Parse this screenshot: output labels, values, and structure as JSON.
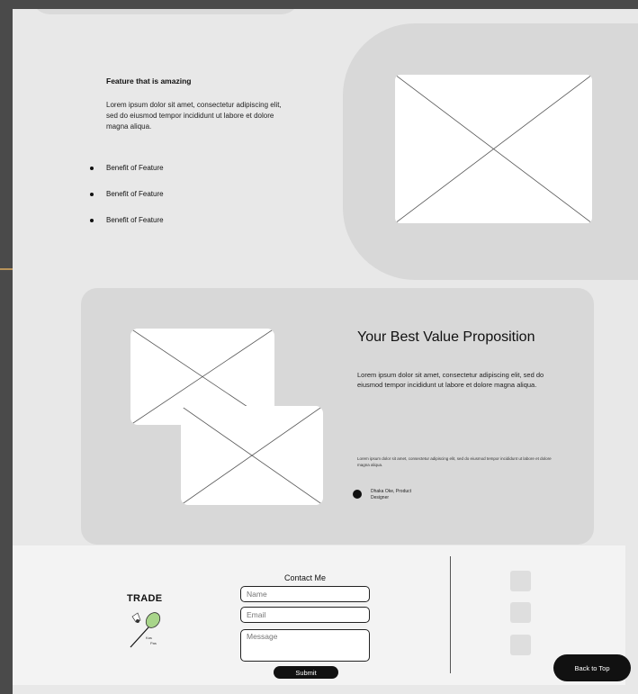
{
  "feature": {
    "title": "Feature that is amazing",
    "description": "Lorem ipsum dolor sit amet, consectetur adipiscing elit, sed do eiusmod tempor incididunt ut labore et dolore magna aliqua.",
    "benefits": [
      "Benefit of Feature",
      "Benefit of Feature",
      "Benefit of Feature"
    ]
  },
  "value_prop": {
    "title": "Your Best Value Proposition",
    "description": "Lorem ipsum dolor sit amet, consectetur adipiscing elit, sed do eiusmod tempor incididunt ut labore et dolore magna aliqua.",
    "quote": "Lorem ipsum dolor sit amet, consectetur adipiscing elit, sed do eiusmod tempor incididunt ut labore et dolore magna aliqua.",
    "author": "Dhaka Oke, Product Designer"
  },
  "footer": {
    "brand": "TRADE",
    "logo_text": "Kas Pas",
    "contact_title": "Contact Me",
    "name_placeholder": "Name",
    "email_placeholder": "Email",
    "message_placeholder": "Message",
    "submit_label": "Submit",
    "back_to_top_label": "Back to Top"
  },
  "colors": {
    "background": "#e8e8e8",
    "card": "#d8d8d8",
    "footer": "#f3f3f3",
    "button": "#111111"
  }
}
